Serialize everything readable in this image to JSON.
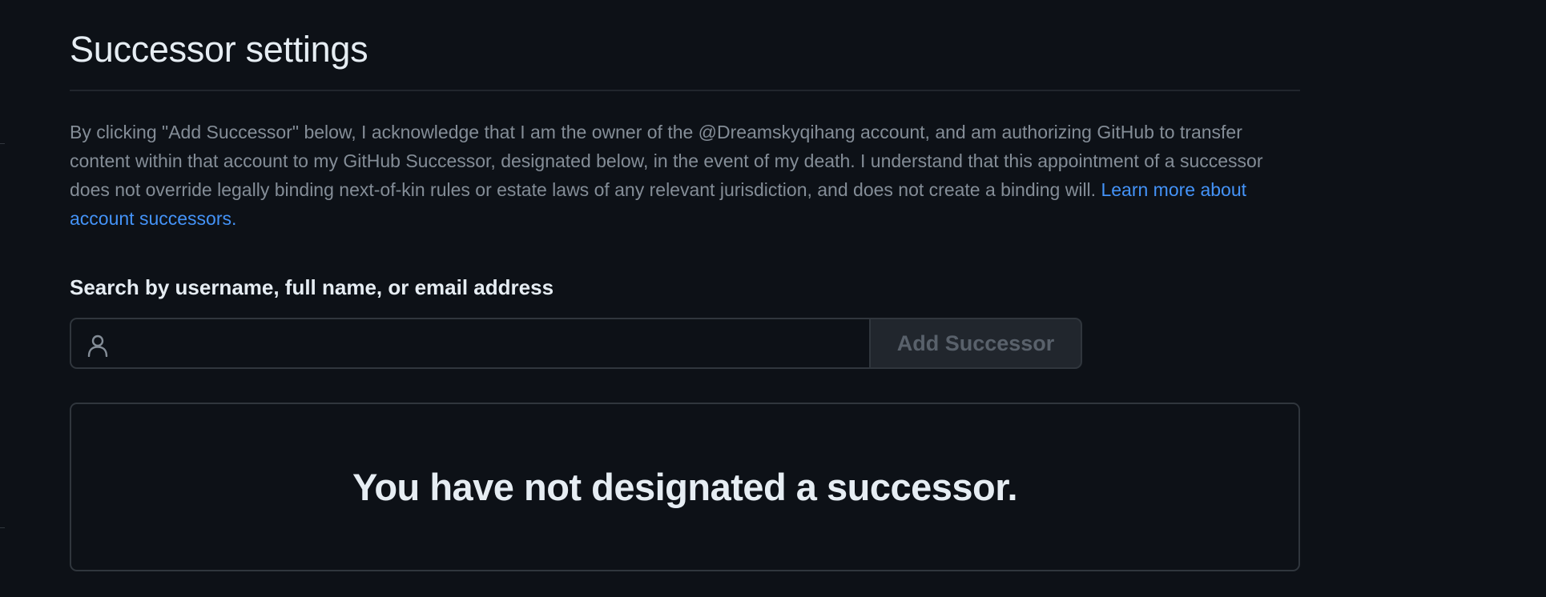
{
  "page": {
    "title": "Successor settings"
  },
  "description": {
    "text": "By clicking \"Add Successor\" below, I acknowledge that I am the owner of the @Dreamskyqihang account, and am authorizing GitHub to transfer content within that account to my GitHub Successor, designated below, in the event of my death. I understand that this appointment of a successor does not override legally binding next-of-kin rules or estate laws of any relevant jurisdiction, and does not create a binding will.",
    "link_label": "Learn more about account successors."
  },
  "search": {
    "label": "Search by username, full name, or email address",
    "value": "",
    "icon": "person-icon",
    "button_label": "Add Successor",
    "button_disabled": true
  },
  "successor_panel": {
    "empty_message": "You have not designated a successor."
  },
  "colors": {
    "background": "#0d1117",
    "text": "#e6edf3",
    "muted": "#848d97",
    "link": "#4493f8",
    "border": "#30363d",
    "button_bg": "#21262d",
    "button_disabled_text": "#59616b"
  }
}
